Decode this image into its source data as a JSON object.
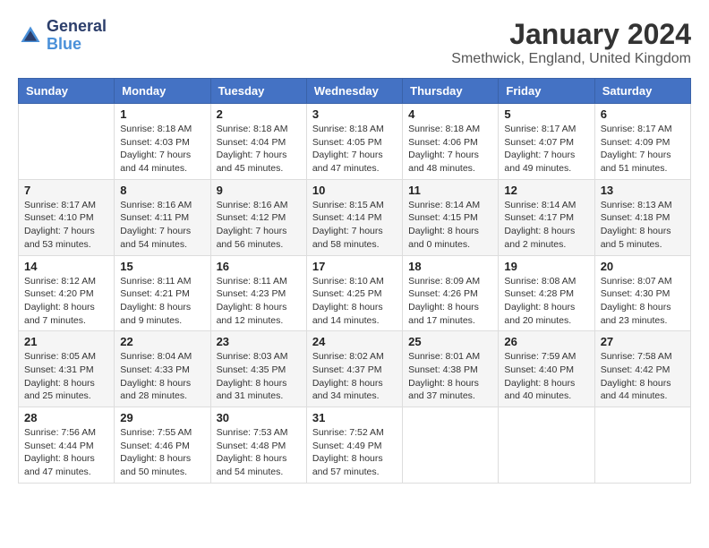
{
  "logo": {
    "text_general": "General",
    "text_blue": "Blue"
  },
  "header": {
    "month": "January 2024",
    "location": "Smethwick, England, United Kingdom"
  },
  "days_of_week": [
    "Sunday",
    "Monday",
    "Tuesday",
    "Wednesday",
    "Thursday",
    "Friday",
    "Saturday"
  ],
  "weeks": [
    [
      {
        "day": "",
        "sunrise": "",
        "sunset": "",
        "daylight": ""
      },
      {
        "day": "1",
        "sunrise": "Sunrise: 8:18 AM",
        "sunset": "Sunset: 4:03 PM",
        "daylight": "Daylight: 7 hours and 44 minutes."
      },
      {
        "day": "2",
        "sunrise": "Sunrise: 8:18 AM",
        "sunset": "Sunset: 4:04 PM",
        "daylight": "Daylight: 7 hours and 45 minutes."
      },
      {
        "day": "3",
        "sunrise": "Sunrise: 8:18 AM",
        "sunset": "Sunset: 4:05 PM",
        "daylight": "Daylight: 7 hours and 47 minutes."
      },
      {
        "day": "4",
        "sunrise": "Sunrise: 8:18 AM",
        "sunset": "Sunset: 4:06 PM",
        "daylight": "Daylight: 7 hours and 48 minutes."
      },
      {
        "day": "5",
        "sunrise": "Sunrise: 8:17 AM",
        "sunset": "Sunset: 4:07 PM",
        "daylight": "Daylight: 7 hours and 49 minutes."
      },
      {
        "day": "6",
        "sunrise": "Sunrise: 8:17 AM",
        "sunset": "Sunset: 4:09 PM",
        "daylight": "Daylight: 7 hours and 51 minutes."
      }
    ],
    [
      {
        "day": "7",
        "sunrise": "Sunrise: 8:17 AM",
        "sunset": "Sunset: 4:10 PM",
        "daylight": "Daylight: 7 hours and 53 minutes."
      },
      {
        "day": "8",
        "sunrise": "Sunrise: 8:16 AM",
        "sunset": "Sunset: 4:11 PM",
        "daylight": "Daylight: 7 hours and 54 minutes."
      },
      {
        "day": "9",
        "sunrise": "Sunrise: 8:16 AM",
        "sunset": "Sunset: 4:12 PM",
        "daylight": "Daylight: 7 hours and 56 minutes."
      },
      {
        "day": "10",
        "sunrise": "Sunrise: 8:15 AM",
        "sunset": "Sunset: 4:14 PM",
        "daylight": "Daylight: 7 hours and 58 minutes."
      },
      {
        "day": "11",
        "sunrise": "Sunrise: 8:14 AM",
        "sunset": "Sunset: 4:15 PM",
        "daylight": "Daylight: 8 hours and 0 minutes."
      },
      {
        "day": "12",
        "sunrise": "Sunrise: 8:14 AM",
        "sunset": "Sunset: 4:17 PM",
        "daylight": "Daylight: 8 hours and 2 minutes."
      },
      {
        "day": "13",
        "sunrise": "Sunrise: 8:13 AM",
        "sunset": "Sunset: 4:18 PM",
        "daylight": "Daylight: 8 hours and 5 minutes."
      }
    ],
    [
      {
        "day": "14",
        "sunrise": "Sunrise: 8:12 AM",
        "sunset": "Sunset: 4:20 PM",
        "daylight": "Daylight: 8 hours and 7 minutes."
      },
      {
        "day": "15",
        "sunrise": "Sunrise: 8:11 AM",
        "sunset": "Sunset: 4:21 PM",
        "daylight": "Daylight: 8 hours and 9 minutes."
      },
      {
        "day": "16",
        "sunrise": "Sunrise: 8:11 AM",
        "sunset": "Sunset: 4:23 PM",
        "daylight": "Daylight: 8 hours and 12 minutes."
      },
      {
        "day": "17",
        "sunrise": "Sunrise: 8:10 AM",
        "sunset": "Sunset: 4:25 PM",
        "daylight": "Daylight: 8 hours and 14 minutes."
      },
      {
        "day": "18",
        "sunrise": "Sunrise: 8:09 AM",
        "sunset": "Sunset: 4:26 PM",
        "daylight": "Daylight: 8 hours and 17 minutes."
      },
      {
        "day": "19",
        "sunrise": "Sunrise: 8:08 AM",
        "sunset": "Sunset: 4:28 PM",
        "daylight": "Daylight: 8 hours and 20 minutes."
      },
      {
        "day": "20",
        "sunrise": "Sunrise: 8:07 AM",
        "sunset": "Sunset: 4:30 PM",
        "daylight": "Daylight: 8 hours and 23 minutes."
      }
    ],
    [
      {
        "day": "21",
        "sunrise": "Sunrise: 8:05 AM",
        "sunset": "Sunset: 4:31 PM",
        "daylight": "Daylight: 8 hours and 25 minutes."
      },
      {
        "day": "22",
        "sunrise": "Sunrise: 8:04 AM",
        "sunset": "Sunset: 4:33 PM",
        "daylight": "Daylight: 8 hours and 28 minutes."
      },
      {
        "day": "23",
        "sunrise": "Sunrise: 8:03 AM",
        "sunset": "Sunset: 4:35 PM",
        "daylight": "Daylight: 8 hours and 31 minutes."
      },
      {
        "day": "24",
        "sunrise": "Sunrise: 8:02 AM",
        "sunset": "Sunset: 4:37 PM",
        "daylight": "Daylight: 8 hours and 34 minutes."
      },
      {
        "day": "25",
        "sunrise": "Sunrise: 8:01 AM",
        "sunset": "Sunset: 4:38 PM",
        "daylight": "Daylight: 8 hours and 37 minutes."
      },
      {
        "day": "26",
        "sunrise": "Sunrise: 7:59 AM",
        "sunset": "Sunset: 4:40 PM",
        "daylight": "Daylight: 8 hours and 40 minutes."
      },
      {
        "day": "27",
        "sunrise": "Sunrise: 7:58 AM",
        "sunset": "Sunset: 4:42 PM",
        "daylight": "Daylight: 8 hours and 44 minutes."
      }
    ],
    [
      {
        "day": "28",
        "sunrise": "Sunrise: 7:56 AM",
        "sunset": "Sunset: 4:44 PM",
        "daylight": "Daylight: 8 hours and 47 minutes."
      },
      {
        "day": "29",
        "sunrise": "Sunrise: 7:55 AM",
        "sunset": "Sunset: 4:46 PM",
        "daylight": "Daylight: 8 hours and 50 minutes."
      },
      {
        "day": "30",
        "sunrise": "Sunrise: 7:53 AM",
        "sunset": "Sunset: 4:48 PM",
        "daylight": "Daylight: 8 hours and 54 minutes."
      },
      {
        "day": "31",
        "sunrise": "Sunrise: 7:52 AM",
        "sunset": "Sunset: 4:49 PM",
        "daylight": "Daylight: 8 hours and 57 minutes."
      },
      {
        "day": "",
        "sunrise": "",
        "sunset": "",
        "daylight": ""
      },
      {
        "day": "",
        "sunrise": "",
        "sunset": "",
        "daylight": ""
      },
      {
        "day": "",
        "sunrise": "",
        "sunset": "",
        "daylight": ""
      }
    ]
  ]
}
